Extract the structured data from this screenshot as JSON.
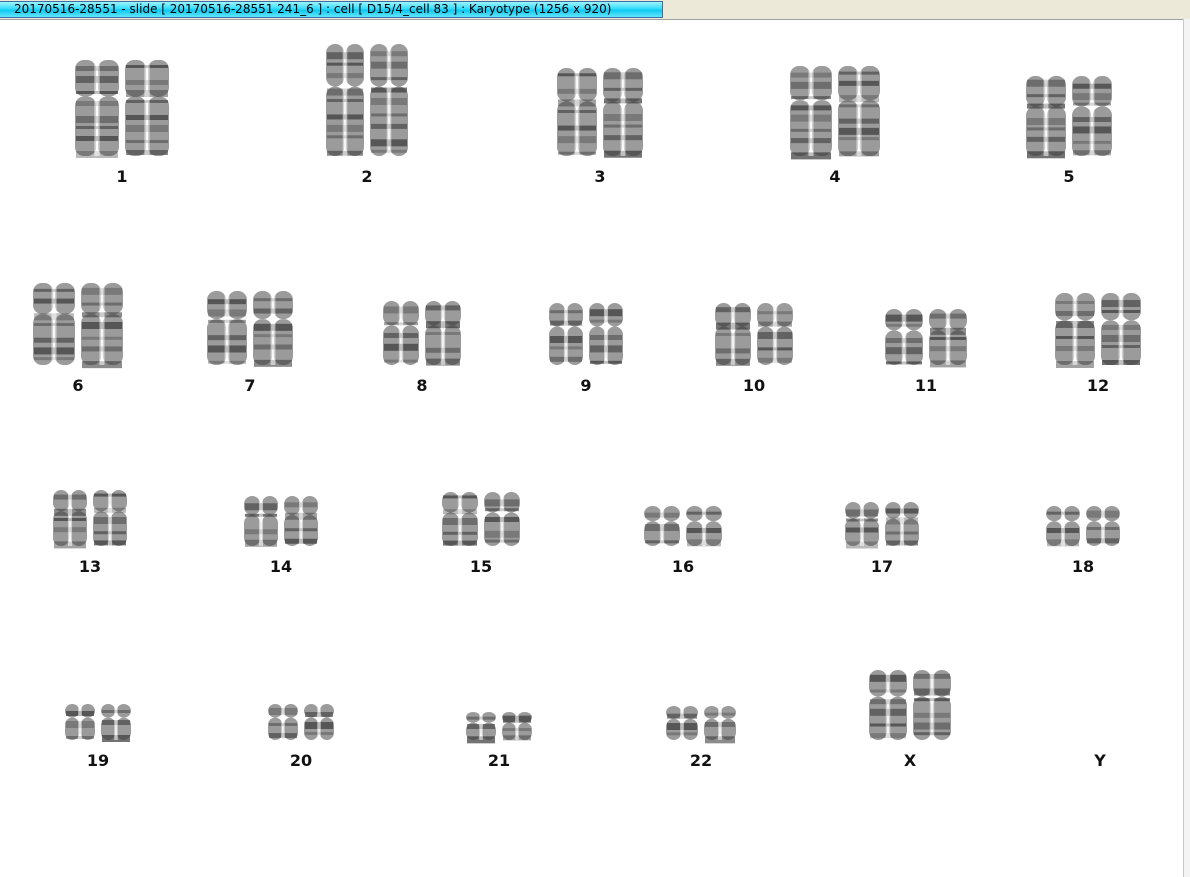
{
  "window": {
    "title": "20170516-28551 - slide [ 20170516-28551 241_6 ] : cell [ D15/4_cell 83 ] : Karyotype  (1256 x 920)"
  },
  "karyotype": {
    "chromosomes": [
      {
        "label": "1",
        "present": true
      },
      {
        "label": "2",
        "present": true
      },
      {
        "label": "3",
        "present": true
      },
      {
        "label": "4",
        "present": true
      },
      {
        "label": "5",
        "present": true
      },
      {
        "label": "6",
        "present": true
      },
      {
        "label": "7",
        "present": true
      },
      {
        "label": "8",
        "present": true
      },
      {
        "label": "9",
        "present": true
      },
      {
        "label": "10",
        "present": true
      },
      {
        "label": "11",
        "present": true
      },
      {
        "label": "12",
        "present": true
      },
      {
        "label": "13",
        "present": true
      },
      {
        "label": "14",
        "present": true
      },
      {
        "label": "15",
        "present": true
      },
      {
        "label": "16",
        "present": true
      },
      {
        "label": "17",
        "present": true
      },
      {
        "label": "18",
        "present": true
      },
      {
        "label": "19",
        "present": true
      },
      {
        "label": "20",
        "present": true
      },
      {
        "label": "21",
        "present": true
      },
      {
        "label": "22",
        "present": true
      },
      {
        "label": "X",
        "present": true
      },
      {
        "label": "Y",
        "present": false
      }
    ]
  }
}
